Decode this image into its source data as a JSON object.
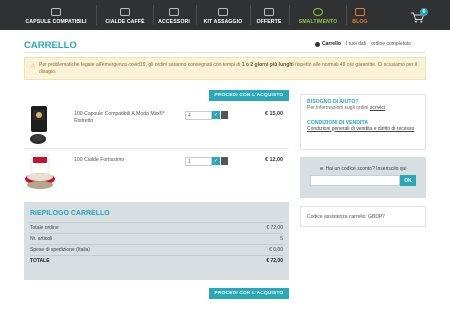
{
  "nav": {
    "items": [
      {
        "label": "CAPSULE COMPATIBILI",
        "icon": "capsule-icon"
      },
      {
        "label": "CIALDE CAFFÈ",
        "icon": "pod-icon"
      },
      {
        "label": "ACCESSORI",
        "icon": "cup-icon"
      },
      {
        "label": "KIT ASSAGGIO",
        "icon": "box-icon"
      },
      {
        "label": "OFFERTE",
        "icon": "tag-icon"
      },
      {
        "label": "SMALTIMENTO",
        "icon": "recycle-icon"
      },
      {
        "label": "BLOG",
        "icon": "blog-icon"
      }
    ],
    "cart_count": "0",
    "colors": {
      "bar": "#2f3133",
      "smaltimento": "#8cc63f",
      "blog": "#e07a3a"
    }
  },
  "header": {
    "title": "CARRELLO",
    "steps": [
      "Carrello",
      "I tuoi dati",
      "ordine completato"
    ]
  },
  "notice": {
    "text_before": "Per problematiche legate all'emergenza covid19, gli ordini saranno consegnati con tempi di ",
    "text_bold": "1 o 2 giorni più lunghi",
    "text_after": " rispetto alle normali 48 ore garantite. Ci scusiamo per il disagio."
  },
  "buttons": {
    "checkout_top": "PROCEDI CON L'ACQUISTO",
    "checkout_bottom": "PROCEDI CON L'ACQUISTO"
  },
  "cart": {
    "items": [
      {
        "name": "100 Capsule Compatibili A Modo Mio®* Ristretto",
        "qty": "4",
        "price": "€ 15,00"
      },
      {
        "name": "100 Cialde Fortissimo",
        "qty": "1",
        "price": "€ 12,00"
      }
    ]
  },
  "summary": {
    "title": "RIEPILOGO CARRELLO",
    "rows": [
      {
        "label": "Totale ordine",
        "value": "€ 72,00"
      },
      {
        "label": "Nr. articoli",
        "value": "5"
      },
      {
        "label": "Spese di spedizione (Italia)",
        "value": "€ 0,00"
      },
      {
        "label": "TOTALE",
        "value": "€ 72,00"
      }
    ]
  },
  "side": {
    "help_title": "BISOGNO DI AIUTO?",
    "help_text": "Per informazioni sugli ordini ",
    "help_link": "scrivici",
    "conditions_title": "CONDIZIONI DI VENDITA",
    "conditions_link": "Condizioni generali di vendita e diritto di recesso",
    "discount_label": "Hai un codice sconto? Inseriscilo qui",
    "discount_button": "OK",
    "assist_text": "Codice assistenza carrello: GBDP7"
  }
}
